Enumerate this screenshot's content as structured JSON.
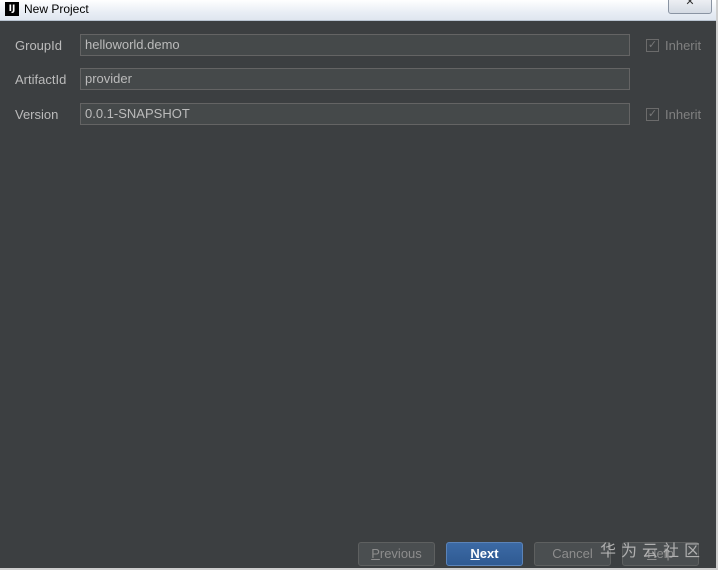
{
  "window": {
    "title": "New Project",
    "app_icon": "intellij-idea-icon",
    "close_label": "✕"
  },
  "form": {
    "group_id": {
      "label": "GroupId",
      "value": "helloworld.demo",
      "inherit_label": "Inherit",
      "inherit_checked": true
    },
    "artifact_id": {
      "label": "ArtifactId",
      "value": "provider"
    },
    "version": {
      "label": "Version",
      "value": "0.0.1-SNAPSHOT",
      "inherit_label": "Inherit",
      "inherit_checked": true
    }
  },
  "buttons": {
    "previous": {
      "mnemonic": "P",
      "rest": "revious"
    },
    "next": {
      "mnemonic": "N",
      "rest": "ext"
    },
    "cancel": "Cancel",
    "help": {
      "mnemonic": "H",
      "rest": "elp"
    }
  },
  "watermark": "华为云社区",
  "colors": {
    "background": "#3c3f41",
    "field_background": "#45494a",
    "primary_button": "#365f97"
  }
}
